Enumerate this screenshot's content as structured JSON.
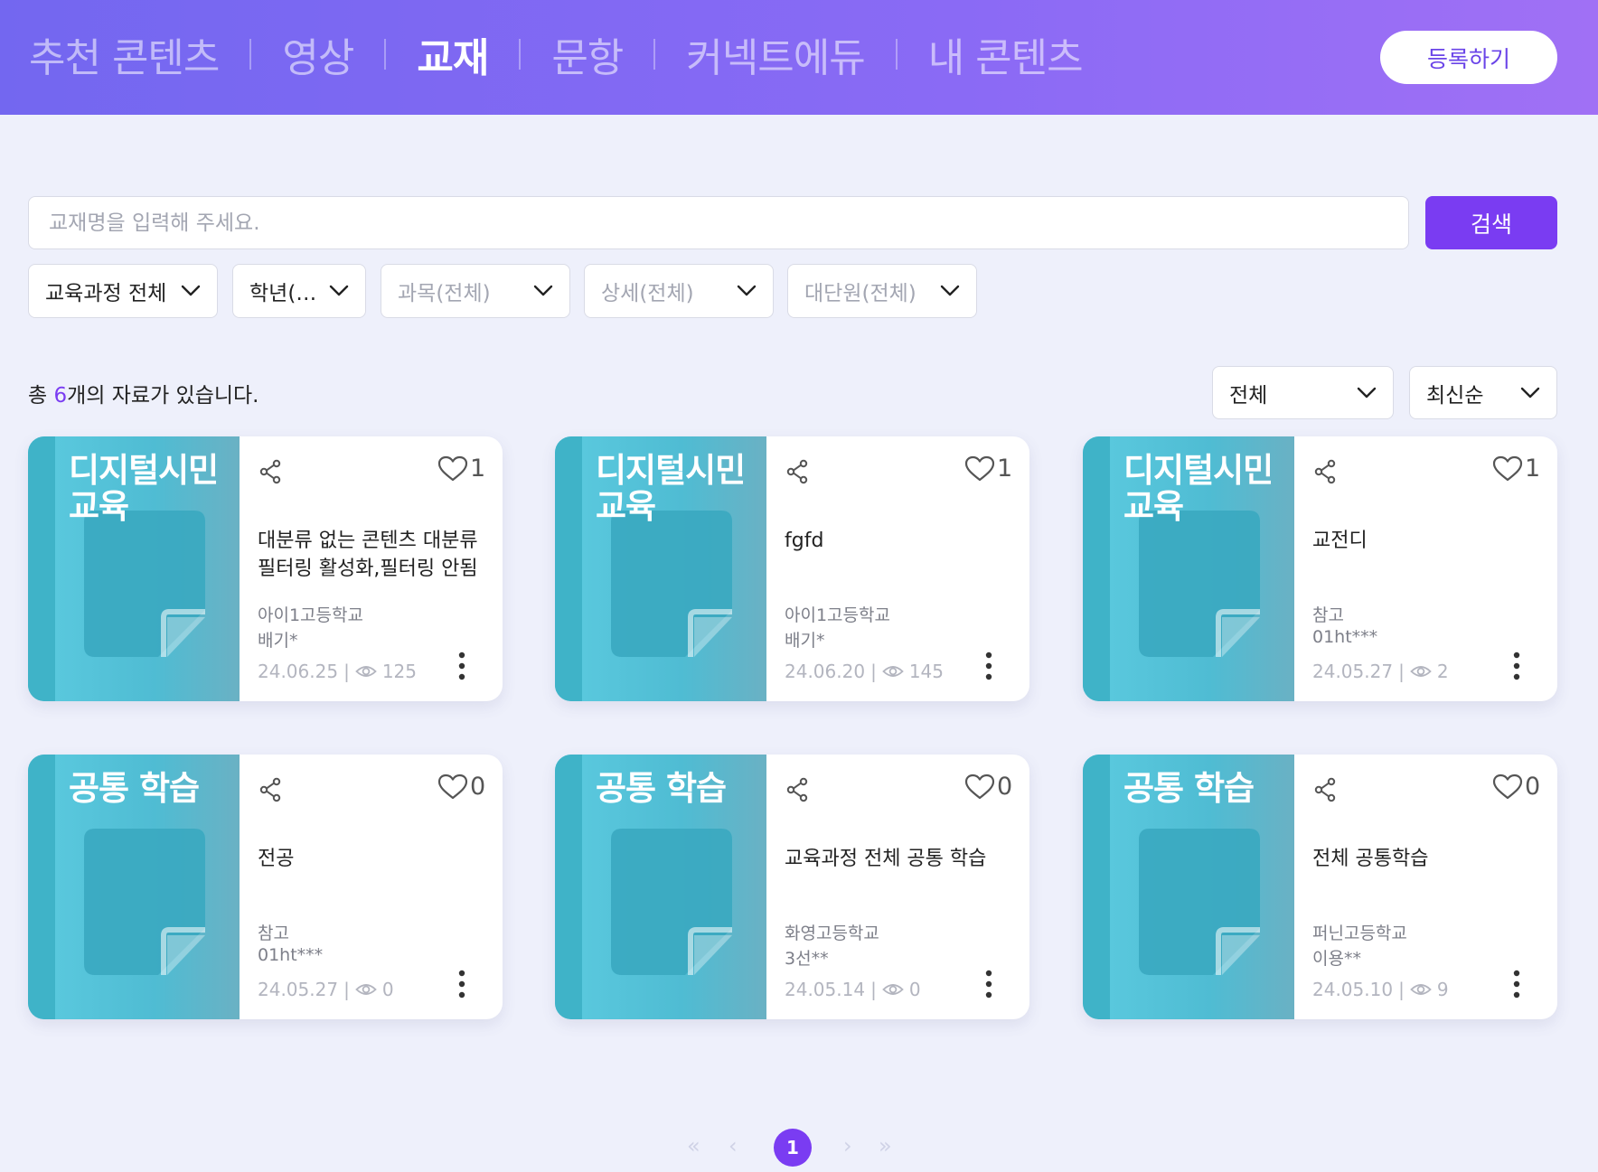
{
  "nav": {
    "items": [
      {
        "label": "추천 콘텐츠",
        "active": false
      },
      {
        "label": "영상",
        "active": false
      },
      {
        "label": "교재",
        "active": true
      },
      {
        "label": "문항",
        "active": false
      },
      {
        "label": "커넥트에듀",
        "active": false
      },
      {
        "label": "내 콘텐츠",
        "active": false
      }
    ],
    "register_label": "등록하기"
  },
  "search": {
    "placeholder": "교재명을 입력해 주세요.",
    "value": "",
    "button_label": "검색"
  },
  "filters": [
    {
      "label": "교육과정 전체",
      "dim": false
    },
    {
      "label": "학년(…",
      "dim": false
    },
    {
      "label": "과목(전체)",
      "dim": true
    },
    {
      "label": "상세(전체)",
      "dim": true
    },
    {
      "label": "대단원(전체)",
      "dim": true
    }
  ],
  "result": {
    "prefix": "총 ",
    "count": "6",
    "suffix": "개의 자료가 있습니다."
  },
  "sort": {
    "type_label": "전체",
    "order_label": "최신순"
  },
  "cards": [
    {
      "category": "디지털시민교육",
      "title": "대분류 없는 콘텐츠 대분류 필터링 활성화,필터링 안됨",
      "school": "아이1고등학교",
      "author": "배기*",
      "date": "24.06.25",
      "views": "125",
      "likes": "1"
    },
    {
      "category": "디지털시민교육",
      "title": "fgfd",
      "school": "아이1고등학교",
      "author": "배기*",
      "date": "24.06.20",
      "views": "145",
      "likes": "1"
    },
    {
      "category": "디지털시민교육",
      "title": "교전디",
      "school": "참고",
      "author": "01ht***",
      "date": "24.05.27",
      "views": "2",
      "likes": "1"
    },
    {
      "category": "공통 학습",
      "title": "전공",
      "school": "참고",
      "author": "01ht***",
      "date": "24.05.27",
      "views": "0",
      "likes": "0"
    },
    {
      "category": "공통 학습",
      "title": "교육과정 전체 공통 학습",
      "school": "화영고등학교",
      "author": "3선**",
      "date": "24.05.14",
      "views": "0",
      "likes": "0"
    },
    {
      "category": "공통 학습",
      "title": "전체 공통학습",
      "school": "퍼닌고등학교",
      "author": "이용**",
      "date": "24.05.10",
      "views": "9",
      "likes": "0"
    }
  ],
  "meta_separator": "|",
  "pagination": {
    "first": "«",
    "prev": "‹",
    "current": "1",
    "next": "›",
    "last": "»"
  },
  "colors": {
    "accent": "#7a3cf2",
    "header_start": "#7367f0",
    "header_end": "#a070f5",
    "thumb": "#4fbcd3"
  }
}
